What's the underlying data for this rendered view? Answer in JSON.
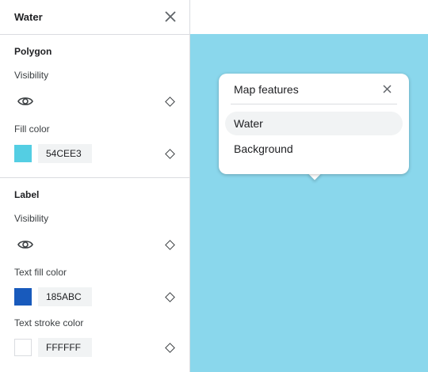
{
  "panel": {
    "title": "Water",
    "sections": [
      {
        "title": "Polygon",
        "visibility_label": "Visibility",
        "fill_label": "Fill color",
        "fill_hex": "54CEE3",
        "fill_color": "#54CEE3"
      },
      {
        "title": "Label",
        "visibility_label": "Visibility",
        "text_fill_label": "Text fill color",
        "text_fill_hex": "185ABC",
        "text_fill_color": "#185ABC",
        "text_stroke_label": "Text stroke color",
        "text_stroke_hex": "FFFFFF",
        "text_stroke_color": "#FFFFFF"
      }
    ]
  },
  "map": {
    "background_color": "#8AD7EC",
    "popup": {
      "title": "Map features",
      "items": [
        "Water",
        "Background"
      ],
      "selected": "Water"
    }
  },
  "icons": [
    "close-icon",
    "eye-icon",
    "diamond-icon"
  ]
}
